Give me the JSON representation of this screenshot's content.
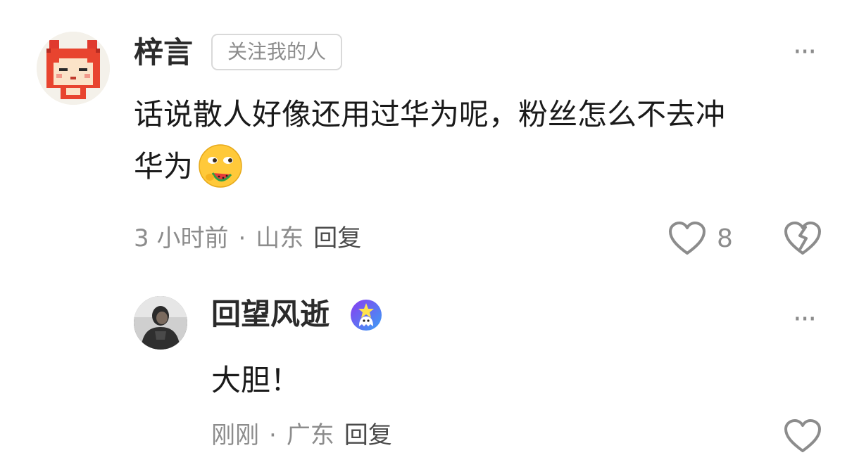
{
  "comment": {
    "username": "梓言",
    "badge": "关注我的人",
    "text_line1": "话说散人好像还用过华为呢，粉丝怎么不去冲",
    "text_line2": "华为",
    "emoji_icon": "watermelon-eating-face-emoji",
    "time": "3 小时前",
    "separator": "·",
    "location": "山东",
    "reply_label": "回复",
    "like_count": "8",
    "more_label": "···"
  },
  "reply": {
    "username": "回望风逝",
    "badge_icon": "star-ghost-badge-icon",
    "text": "大胆！",
    "time": "刚刚",
    "separator": "·",
    "location": "广东",
    "reply_label": "回复",
    "more_label": "···"
  },
  "colors": {
    "secondary_text": "#8c8c8c",
    "primary_text": "#1a1a1a",
    "badge_border": "#d9d9d9"
  }
}
